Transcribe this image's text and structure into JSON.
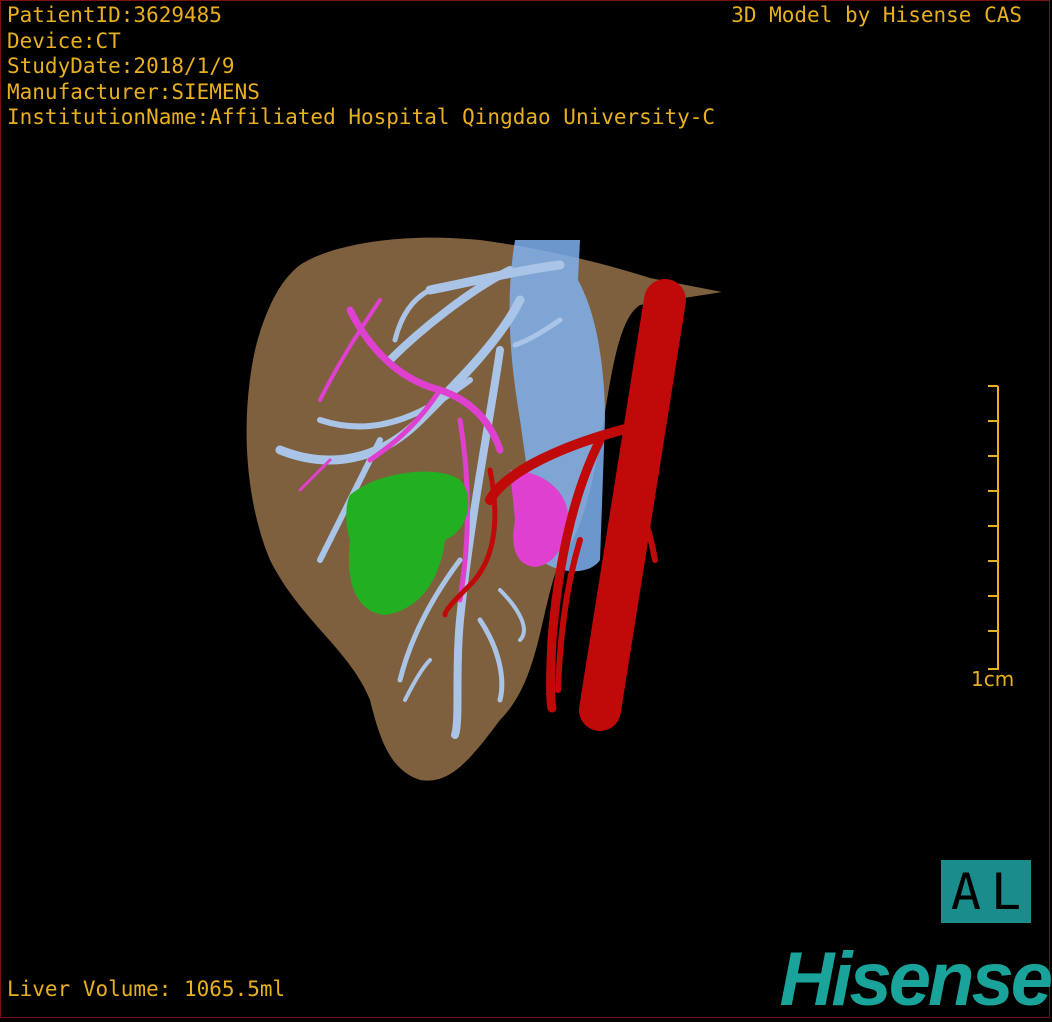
{
  "header": {
    "patient_id": "PatientID:3629485",
    "device": "Device:CT",
    "study_date": "StudyDate:2018/1/9",
    "manufacturer": "Manufacturer:SIEMENS",
    "institution": "InstitutionName:Affiliated Hospital Qingdao University-C"
  },
  "credit": "3D Model by Hisense CAS",
  "footer": {
    "volume": "Liver Volume: 1065.5ml"
  },
  "scale": {
    "label": "1cm"
  },
  "orientation": {
    "left": "A",
    "right": "L"
  },
  "brand": {
    "logo": "Hisense"
  },
  "colors": {
    "text": "#e8b020",
    "liver": "#8c6a45",
    "portal_vein": "#a9c4e6",
    "hepatic_artery": "#d01010",
    "bile_duct": "#e040d0",
    "lesion": "#22b022",
    "vena_cava": "#7fb2f0",
    "brand": "#1aa39a"
  },
  "structures": [
    "liver-icon",
    "vena-cava-icon",
    "portal-vein-icon",
    "bile-duct-icon",
    "artery-icon",
    "lesion-icon"
  ]
}
